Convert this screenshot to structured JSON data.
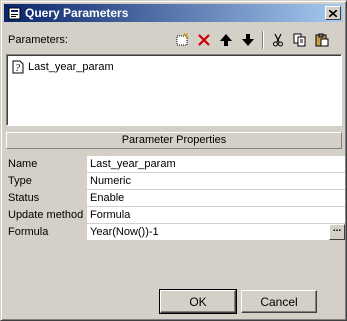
{
  "window": {
    "title": "Query Parameters"
  },
  "parameters": {
    "label": "Parameters:",
    "items": [
      {
        "label": "Last_year_param"
      }
    ]
  },
  "toolbar": {
    "icons": [
      "new-icon",
      "delete-icon",
      "move-up-icon",
      "move-down-icon",
      "cut-icon",
      "copy-icon",
      "paste-icon"
    ]
  },
  "properties": {
    "header": "Parameter Properties",
    "rows": [
      {
        "label": "Name",
        "value": "Last_year_param"
      },
      {
        "label": "Type",
        "value": "Numeric"
      },
      {
        "label": "Status",
        "value": "Enable"
      },
      {
        "label": "Update method",
        "value": "Formula"
      },
      {
        "label": "Formula",
        "value": "Year(Now())-1"
      }
    ],
    "formula_button": "..."
  },
  "buttons": {
    "ok": "OK",
    "cancel": "Cancel"
  },
  "colors": {
    "titlebar_start": "#0a246a",
    "titlebar_end": "#a6caf0",
    "face": "#d4d0c8",
    "delete_red": "#cc0000"
  }
}
